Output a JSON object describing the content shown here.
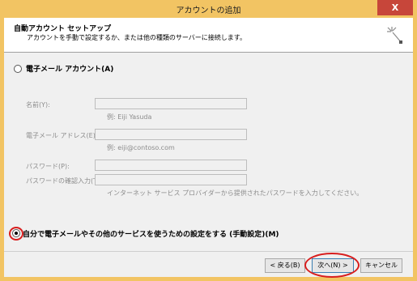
{
  "window": {
    "title": "アカウントの追加",
    "close_glyph": "X"
  },
  "header": {
    "title": "自動アカウント セットアップ",
    "subtitle": "アカウントを手動で設定するか、または他の種類のサーバーに接続します。",
    "icon": "wizard-sparkle-icon"
  },
  "options": {
    "email_account": {
      "label": "電子メール アカウント(A)",
      "selected": false
    },
    "manual_setup": {
      "label": "自分で電子メールやその他のサービスを使うための設定をする (手動設定)(M)",
      "selected": true
    }
  },
  "fields": {
    "name": {
      "label": "名前(Y):",
      "value": "",
      "hint": "例: Eiji Yasuda"
    },
    "email": {
      "label": "電子メール アドレス(E):",
      "value": "",
      "hint": "例: eiji@contoso.com"
    },
    "password": {
      "label": "パスワード(P):",
      "value": ""
    },
    "password_confirm": {
      "label": "パスワードの確認入力(T):",
      "value": ""
    },
    "password_hint": "インターネット サービス プロバイダーから提供されたパスワードを入力してください。"
  },
  "buttons": {
    "back": "< 戻る(B)",
    "next": "次へ(N) >",
    "cancel": "キャンセル"
  },
  "colors": {
    "title_bar": "#f2c463",
    "close": "#c7463a",
    "highlight": "#d81e1e"
  }
}
